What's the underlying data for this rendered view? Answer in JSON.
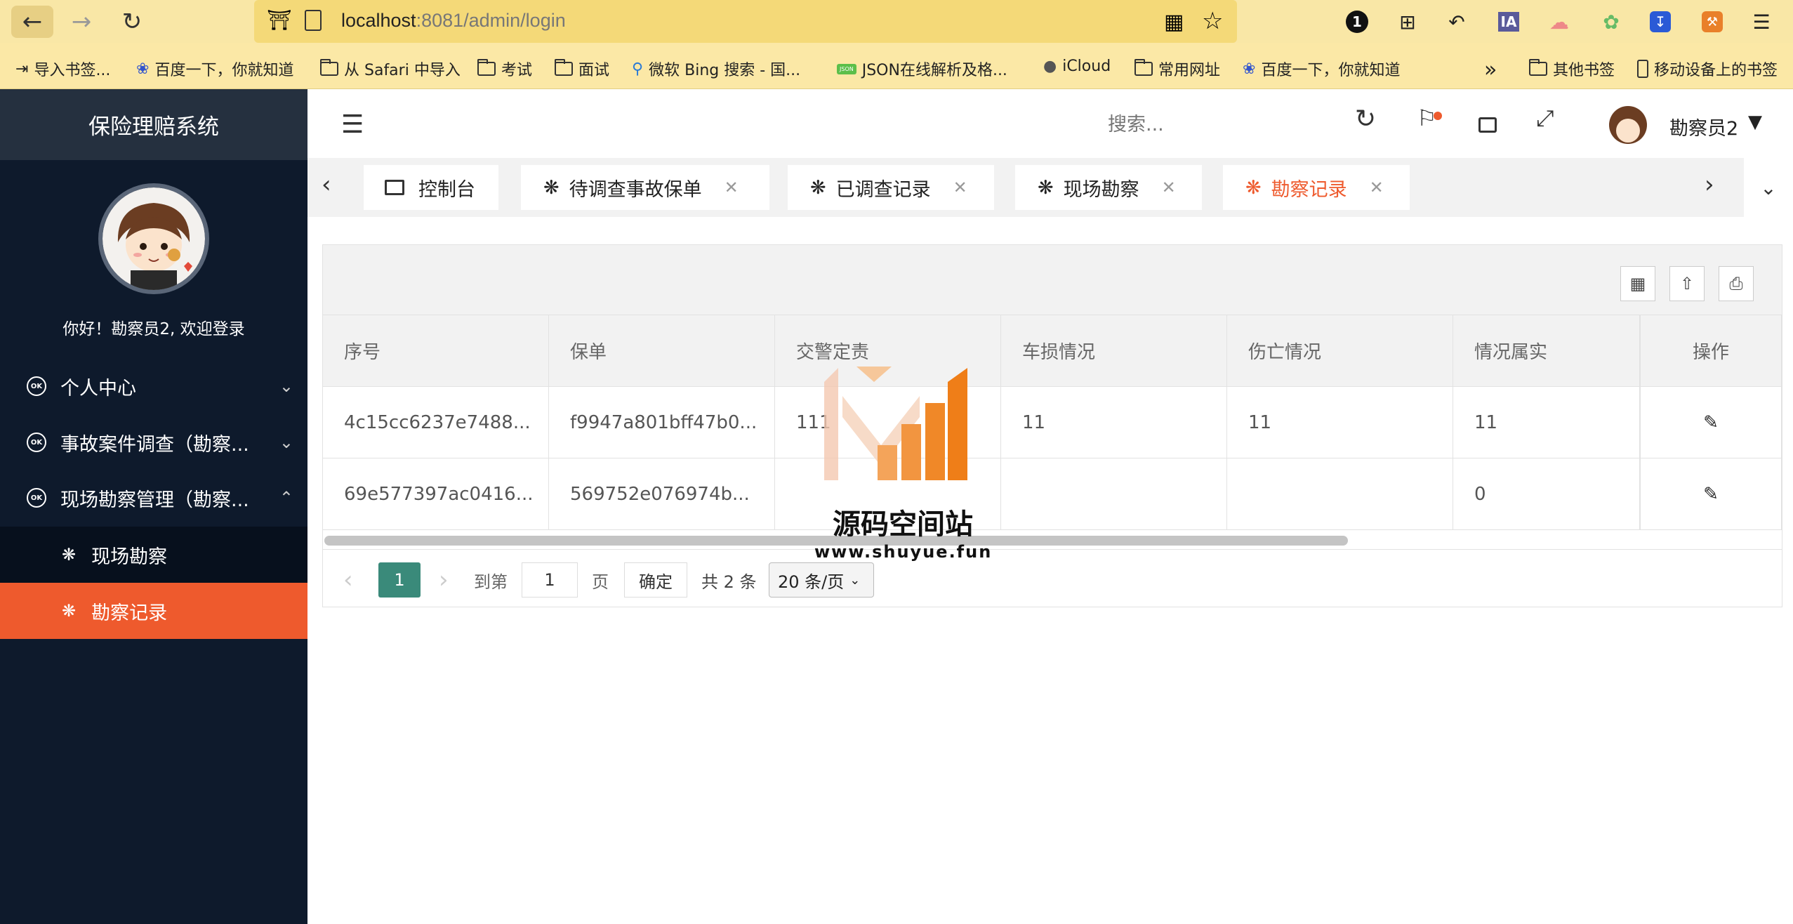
{
  "browser": {
    "url_host": "localhost",
    "url_path": ":8081/admin/login",
    "bookmarks": [
      {
        "label": "导入书签..."
      },
      {
        "label": "百度一下，你就知道"
      },
      {
        "label": "从 Safari 中导入"
      },
      {
        "label": "考试"
      },
      {
        "label": "面试"
      },
      {
        "label": "微软 Bing 搜索 - 国..."
      },
      {
        "label": "JSON在线解析及格..."
      },
      {
        "label": "iCloud"
      },
      {
        "label": "常用网址"
      },
      {
        "label": "百度一下，你就知道"
      }
    ],
    "bookmarks_right": [
      {
        "label": "其他书签"
      },
      {
        "label": "移动设备上的书签"
      }
    ],
    "ext_ia": "IA"
  },
  "sidebar": {
    "system_title": "保险理赔系统",
    "welcome": "你好！勘察员2, 欢迎登录",
    "menus": [
      {
        "label": "个人中心",
        "expanded": false
      },
      {
        "label": "事故案件调查（勘察...",
        "expanded": false
      },
      {
        "label": "现场勘察管理（勘察...",
        "expanded": true
      }
    ],
    "submenus": [
      {
        "label": "现场勘察",
        "active": false
      },
      {
        "label": "勘察记录",
        "active": true
      }
    ]
  },
  "header": {
    "search_placeholder": "搜索...",
    "username": "勘察员2"
  },
  "tabs": [
    {
      "label": "控制台",
      "closable": false,
      "active": false
    },
    {
      "label": "待调查事故保单",
      "closable": true,
      "active": false
    },
    {
      "label": "已调查记录",
      "closable": true,
      "active": false
    },
    {
      "label": "现场勘察",
      "closable": true,
      "active": false
    },
    {
      "label": "勘察记录",
      "closable": true,
      "active": true
    }
  ],
  "table": {
    "columns": [
      "序号",
      "保单",
      "交警定责",
      "车损情况",
      "伤亡情况",
      "情况属实",
      "操作"
    ],
    "rows": [
      [
        "4c15cc6237e7488...",
        "f9947a801bff47b0...",
        "111",
        "11",
        "11",
        "11"
      ],
      [
        "69e577397ac0416...",
        "569752e076974b...",
        "",
        "",
        "",
        "0"
      ]
    ]
  },
  "pager": {
    "current_page": "1",
    "goto_label": "到第",
    "goto_value": "1",
    "page_suffix": "页",
    "confirm": "确定",
    "total": "共 2 条",
    "page_size": "20 条/页"
  },
  "watermark": {
    "title": "源码空间站",
    "url": "www.shuyue.fun"
  },
  "colors": {
    "accent": "#ee5a2d",
    "sidebar_bg": "#0e1a2c",
    "pager_active": "#3a8a7a"
  }
}
